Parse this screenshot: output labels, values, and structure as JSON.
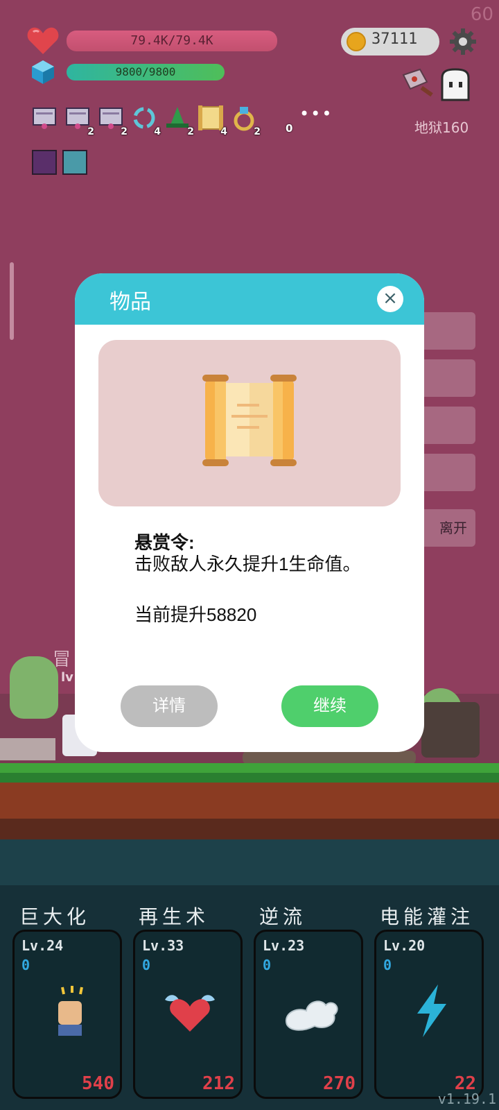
{
  "hud": {
    "fps": "60",
    "hp": "79.4K/79.4K",
    "mp": "9800/9800",
    "coins": "37111",
    "stage": "地狱160"
  },
  "items": [
    {
      "icon": "scroll-banner-icon",
      "count": ""
    },
    {
      "icon": "scroll-banner-icon",
      "count": "2"
    },
    {
      "icon": "scroll-banner-icon",
      "count": "2"
    },
    {
      "icon": "cycle-arrows-icon",
      "count": "4"
    },
    {
      "icon": "green-hat-icon",
      "count": "2"
    },
    {
      "icon": "parchment-scroll-icon",
      "count": "4"
    },
    {
      "icon": "gem-ring-icon",
      "count": "2"
    }
  ],
  "items_extra_count": "0",
  "more": "•••",
  "side_buttons": {
    "leave_label": "离开"
  },
  "background_text": {
    "name": "冒",
    "level": "lv"
  },
  "modal": {
    "title": "物品",
    "close": "×",
    "item_name": "悬赏令:",
    "description": "击败敌人永久提升1生命值。",
    "current": "当前提升58820",
    "details_button": "详情",
    "continue_button": "继续"
  },
  "skills": [
    {
      "name": "巨大化",
      "level": "Lv.24",
      "points": "0",
      "cost": "540",
      "icon": "fist-icon"
    },
    {
      "name": "再生术",
      "level": "Lv.33",
      "points": "0",
      "cost": "212",
      "icon": "winged-heart-icon"
    },
    {
      "name": "逆流",
      "level": "Lv.23",
      "points": "0",
      "cost": "270",
      "icon": "cloud-wing-icon"
    },
    {
      "name": "电能灌注",
      "level": "Lv.20",
      "points": "0",
      "cost": "22",
      "icon": "lightning-icon"
    }
  ],
  "version": "v1.19.1",
  "colors": {
    "header": "#3cc5d6",
    "continue": "#4fcf6c",
    "details": "#bdbdbd",
    "cost": "#e0404a"
  }
}
